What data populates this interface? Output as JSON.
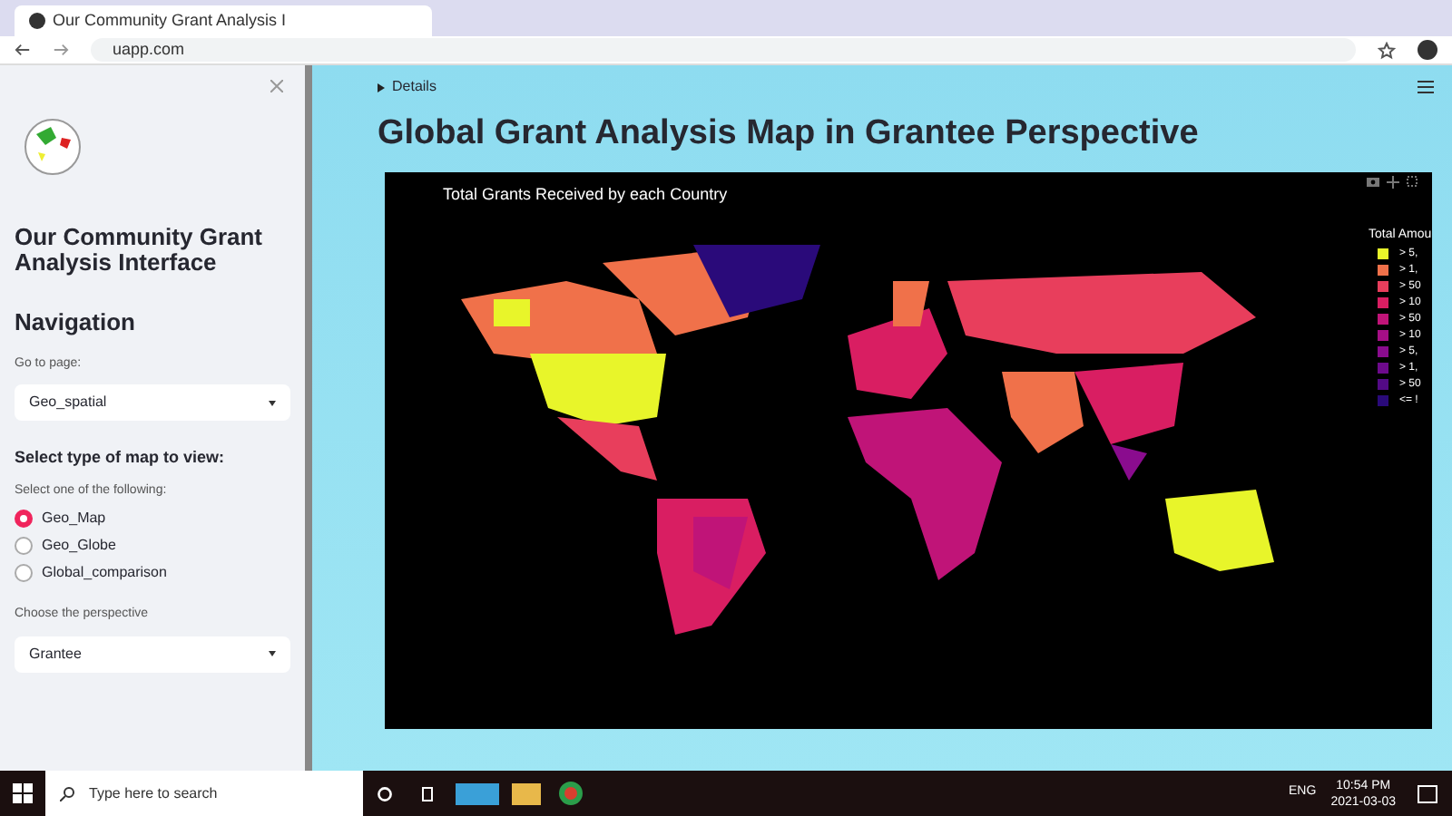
{
  "browser": {
    "tab_title": "Our Community Grant Analysis I",
    "url": "uapp.com"
  },
  "sidebar": {
    "title": "Our Community Grant Analysis Interface",
    "nav_heading": "Navigation",
    "page_label": "Go to page:",
    "page_value": "Geo_spatial",
    "map_heading": "Select type of map to view:",
    "map_label": "Select one of the following:",
    "map_options": [
      {
        "label": "Geo_Map",
        "selected": true
      },
      {
        "label": "Geo_Globe",
        "selected": false
      },
      {
        "label": "Global_comparison",
        "selected": false
      }
    ],
    "perspective_label": "Choose the perspective",
    "perspective_value": "Grantee"
  },
  "main": {
    "details": "Details",
    "title": "Global Grant Analysis Map in Grantee Perspective",
    "map": {
      "title": "Total Grants Received by each Country",
      "legend_title": "Total Amou",
      "legend": [
        {
          "label": "> 5,",
          "color": "#e8f52a"
        },
        {
          "label": "> 1,",
          "color": "#f0714a"
        },
        {
          "label": "> 50",
          "color": "#e83e5c"
        },
        {
          "label": "> 10",
          "color": "#d91e62"
        },
        {
          "label": "> 50",
          "color": "#c01478"
        },
        {
          "label": "> 10",
          "color": "#a50f86"
        },
        {
          "label": "> 5,",
          "color": "#8a0c8e"
        },
        {
          "label": "> 1,",
          "color": "#6d0a8c"
        },
        {
          "label": "> 50",
          "color": "#530a86"
        },
        {
          "label": "<= !",
          "color": "#2a0a7a"
        }
      ]
    }
  },
  "taskbar": {
    "search_placeholder": "Type here to search",
    "time": "10:54 PM",
    "date": "2021-03-03",
    "lang": "ENG"
  }
}
